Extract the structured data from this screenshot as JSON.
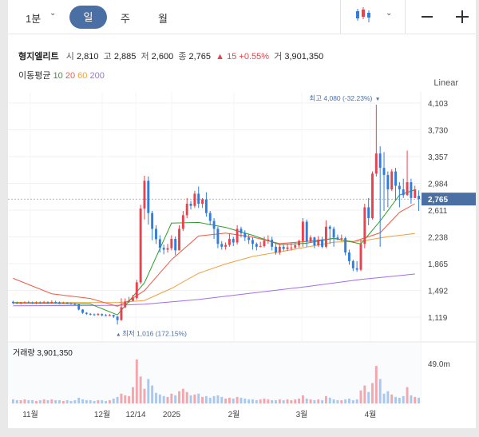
{
  "toolbar": {
    "interval": "1분",
    "tab_day": "일",
    "tab_week": "주",
    "tab_month": "월"
  },
  "stock": {
    "name": "형지엘리트",
    "open_label": "시",
    "open": "2,810",
    "high_label": "고",
    "high": "2,885",
    "low_label": "저",
    "low": "2,600",
    "close_label": "종",
    "close": "2,765",
    "change": "▲ 15",
    "change_pct": "+0.55%",
    "volume_label": "거",
    "volume": "3,901,350"
  },
  "moving_average": {
    "label": "이동평균",
    "periods": [
      {
        "name": "10",
        "color": "#2ca02c"
      },
      {
        "name": "20",
        "color": "#ef5a45"
      },
      {
        "name": "60",
        "color": "#f0a040"
      },
      {
        "name": "200",
        "color": "#a36bf0"
      }
    ]
  },
  "colors": {
    "up": "#e8424e",
    "down": "#2f7de1",
    "accent": "#4a6fa5",
    "vol_up": "#f3a6ab",
    "vol_down": "#a9c8ef"
  },
  "chart_data": {
    "type": "candlestick",
    "scale_label": "Linear",
    "y_ticks": [
      "4,103",
      "3,730",
      "3,357",
      "2,984",
      "2,611",
      "2,238",
      "1,865",
      "1,492",
      "1,119"
    ],
    "ylim": [
      1000,
      4200
    ],
    "current_price": "2,765",
    "x_labels": [
      "11월",
      "12월",
      "12/14",
      "2025",
      "2월",
      "3월",
      "4월"
    ],
    "high_annotation": "최고 4,080 (-32.23%)",
    "low_annotation": "최저 1,016 (172.15%)",
    "volume_label": "거래량",
    "volume_value": "3,901,350",
    "volume_axis_label": "49.0m",
    "candles": [
      [
        1332,
        1316,
        1348,
        1300
      ],
      [
        1320,
        1310,
        1335,
        1300
      ],
      [
        1312,
        1318,
        1332,
        1296
      ],
      [
        1318,
        1325,
        1340,
        1305
      ],
      [
        1325,
        1320,
        1345,
        1310
      ],
      [
        1320,
        1313,
        1336,
        1302
      ],
      [
        1313,
        1322,
        1340,
        1300
      ],
      [
        1322,
        1318,
        1338,
        1305
      ],
      [
        1318,
        1326,
        1345,
        1308
      ],
      [
        1326,
        1320,
        1341,
        1306
      ],
      [
        1320,
        1330,
        1352,
        1310
      ],
      [
        1330,
        1324,
        1348,
        1312
      ],
      [
        1324,
        1313,
        1337,
        1300
      ],
      [
        1313,
        1318,
        1333,
        1302
      ],
      [
        1318,
        1311,
        1330,
        1300
      ],
      [
        1311,
        1302,
        1322,
        1290
      ],
      [
        1302,
        1297,
        1318,
        1287
      ],
      [
        1297,
        1225,
        1302,
        1214
      ],
      [
        1225,
        1180,
        1232,
        1165
      ],
      [
        1180,
        1165,
        1190,
        1150
      ],
      [
        1165,
        1158,
        1178,
        1144
      ],
      [
        1158,
        1150,
        1170,
        1138
      ],
      [
        1150,
        1162,
        1176,
        1140
      ],
      [
        1162,
        1146,
        1170,
        1130
      ],
      [
        1146,
        1145,
        1164,
        1132
      ],
      [
        1145,
        1149,
        1162,
        1133
      ],
      [
        1149,
        1128,
        1155,
        1108
      ],
      [
        1128,
        1078,
        1134,
        1016
      ],
      [
        1078,
        1258,
        1383,
        1070
      ],
      [
        1258,
        1338,
        1380,
        1242
      ],
      [
        1338,
        1345,
        1402,
        1320
      ],
      [
        1345,
        1385,
        1432,
        1358
      ],
      [
        1385,
        1604,
        1640,
        1360
      ],
      [
        1604,
        2633,
        2684,
        1580
      ],
      [
        2633,
        3020,
        3090,
        2480
      ],
      [
        3020,
        2570,
        3080,
        2410
      ],
      [
        2570,
        2350,
        2600,
        2190
      ],
      [
        2350,
        2205,
        2400,
        2140
      ],
      [
        2205,
        2085,
        2260,
        2020
      ],
      [
        2085,
        2060,
        2130,
        1995
      ],
      [
        2060,
        2080,
        2140,
        2020
      ],
      [
        2080,
        2210,
        2260,
        2050
      ],
      [
        2210,
        2050,
        2244,
        1982
      ],
      [
        2050,
        2350,
        2400,
        2050
      ],
      [
        2350,
        2540,
        2600,
        2320
      ],
      [
        2540,
        2700,
        2780,
        2500
      ],
      [
        2700,
        2670,
        2740,
        2620
      ],
      [
        2670,
        2840,
        2880,
        2640
      ],
      [
        2840,
        2700,
        2940,
        2640
      ],
      [
        2700,
        2760,
        2780,
        2640
      ],
      [
        2760,
        2570,
        2860,
        2520
      ],
      [
        2570,
        2460,
        2600,
        2400
      ],
      [
        2460,
        2350,
        2500,
        2210
      ],
      [
        2350,
        2140,
        2380,
        2080
      ],
      [
        2140,
        2100,
        2180,
        2060
      ],
      [
        2100,
        2125,
        2160,
        2060
      ],
      [
        2125,
        2210,
        2280,
        2100
      ],
      [
        2210,
        2160,
        2240,
        2110
      ],
      [
        2160,
        2350,
        2400,
        2130
      ],
      [
        2350,
        2290,
        2380,
        2230
      ],
      [
        2290,
        2230,
        2330,
        2180
      ],
      [
        2230,
        2195,
        2270,
        2140
      ],
      [
        2195,
        2140,
        2230,
        2060
      ],
      [
        2140,
        2100,
        2160,
        2050
      ],
      [
        2100,
        2110,
        2170,
        2090
      ],
      [
        2110,
        2185,
        2240,
        2090
      ],
      [
        2185,
        2200,
        2260,
        2140
      ],
      [
        2200,
        2100,
        2240,
        2050
      ],
      [
        2100,
        2020,
        2140,
        1990
      ],
      [
        2020,
        2100,
        2140,
        1990
      ],
      [
        2100,
        2070,
        2130,
        2040
      ],
      [
        2070,
        2090,
        2140,
        2040
      ],
      [
        2090,
        2090,
        2150,
        2050
      ],
      [
        2090,
        2120,
        2160,
        2070
      ],
      [
        2120,
        2180,
        2200,
        2090
      ],
      [
        2180,
        2450,
        2500,
        2100
      ],
      [
        2450,
        2170,
        2480,
        2100
      ],
      [
        2170,
        2230,
        2260,
        2160
      ],
      [
        2230,
        2120,
        2240,
        2080
      ],
      [
        2120,
        2200,
        2250,
        2100
      ],
      [
        2200,
        2100,
        2240,
        2080
      ],
      [
        2100,
        2380,
        2470,
        2080
      ],
      [
        2380,
        2350,
        2400,
        2140
      ],
      [
        2350,
        2230,
        2380,
        2100
      ],
      [
        2230,
        2210,
        2270,
        2190
      ],
      [
        2210,
        2220,
        2270,
        2180
      ],
      [
        2220,
        2020,
        2240,
        1980
      ],
      [
        2020,
        1900,
        2060,
        1850
      ],
      [
        1900,
        1800,
        1920,
        1760
      ],
      [
        1800,
        1780,
        1900,
        1750
      ],
      [
        1780,
        2140,
        2200,
        1760
      ],
      [
        2140,
        2650,
        2700,
        2080
      ],
      [
        2650,
        2500,
        2780,
        2400
      ],
      [
        2500,
        3120,
        3150,
        2480
      ],
      [
        3120,
        3400,
        4080,
        3080
      ],
      [
        3400,
        3200,
        3500,
        2100
      ],
      [
        3200,
        3100,
        3420,
        2600
      ],
      [
        3100,
        2900,
        3150,
        2650
      ],
      [
        2900,
        3150,
        3180,
        2880
      ],
      [
        3150,
        2950,
        3200,
        2750
      ],
      [
        2950,
        2900,
        3000,
        2650
      ],
      [
        2900,
        2820,
        3050,
        2780
      ],
      [
        2820,
        3000,
        3440,
        2810
      ],
      [
        3000,
        2780,
        3050,
        2700
      ],
      [
        2780,
        2900,
        2950,
        2780
      ],
      [
        2810,
        2765,
        2885,
        2600
      ]
    ],
    "ma10": [
      [
        0,
        1318
      ],
      [
        20,
        1303
      ],
      [
        27,
        1150
      ],
      [
        34,
        1600
      ],
      [
        41,
        2430
      ],
      [
        48,
        2440
      ],
      [
        55,
        2370
      ],
      [
        62,
        2260
      ],
      [
        69,
        2130
      ],
      [
        76,
        2150
      ],
      [
        83,
        2220
      ],
      [
        90,
        2140
      ],
      [
        95,
        2460
      ],
      [
        100,
        2820
      ],
      [
        104,
        2895
      ]
    ],
    "ma20": [
      [
        0,
        1660
      ],
      [
        10,
        1445
      ],
      [
        20,
        1380
      ],
      [
        27,
        1270
      ],
      [
        30,
        1350
      ],
      [
        34,
        1490
      ],
      [
        41,
        1920
      ],
      [
        48,
        2250
      ],
      [
        55,
        2290
      ],
      [
        62,
        2235
      ],
      [
        69,
        2145
      ],
      [
        76,
        2175
      ],
      [
        83,
        2215
      ],
      [
        88,
        2170
      ],
      [
        95,
        2295
      ],
      [
        100,
        2580
      ],
      [
        104,
        2700
      ]
    ],
    "ma60": [
      [
        0,
        1325
      ],
      [
        27,
        1322
      ],
      [
        34,
        1352
      ],
      [
        41,
        1520
      ],
      [
        48,
        1730
      ],
      [
        55,
        1860
      ],
      [
        62,
        1965
      ],
      [
        69,
        2030
      ],
      [
        76,
        2095
      ],
      [
        83,
        2165
      ],
      [
        90,
        2180
      ],
      [
        97,
        2240
      ],
      [
        104,
        2285
      ]
    ],
    "ma200": [
      [
        0,
        1278
      ],
      [
        27,
        1285
      ],
      [
        34,
        1300
      ],
      [
        48,
        1365
      ],
      [
        62,
        1455
      ],
      [
        76,
        1545
      ],
      [
        90,
        1645
      ],
      [
        104,
        1720
      ]
    ],
    "volume": [
      5,
      4,
      4,
      5,
      4,
      4,
      3,
      4,
      5,
      4,
      5,
      4,
      4,
      3,
      4,
      3,
      4,
      7,
      5,
      4,
      4,
      3,
      4,
      4,
      3,
      4,
      6,
      8,
      12,
      10,
      9,
      20,
      54,
      33,
      18,
      30,
      22,
      13,
      11,
      9,
      8,
      12,
      10,
      15,
      18,
      14,
      10,
      11,
      12,
      8,
      9,
      7,
      9,
      10,
      8,
      6,
      7,
      6,
      8,
      7,
      6,
      5,
      5,
      4,
      5,
      6,
      5,
      4,
      4,
      5,
      4,
      5,
      4,
      5,
      6,
      10,
      6,
      5,
      4,
      5,
      4,
      9,
      7,
      5,
      4,
      4,
      5,
      6,
      4,
      5,
      16,
      22,
      14,
      25,
      46,
      30,
      12,
      15,
      11,
      8,
      7,
      9,
      20,
      10,
      8,
      7
    ]
  }
}
